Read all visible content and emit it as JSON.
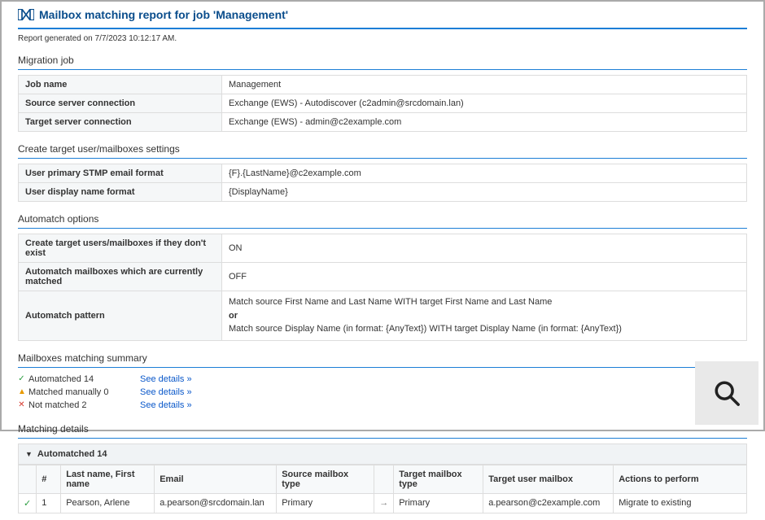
{
  "title": "Mailbox matching report for job 'Management'",
  "generated": "Report generated on 7/7/2023 10:12:17 AM.",
  "section1": {
    "title": "Migration job",
    "rows": [
      {
        "k": "Job name",
        "v": "Management"
      },
      {
        "k": "Source server connection",
        "v": "Exchange (EWS) - Autodiscover (c2admin@srcdomain.lan)"
      },
      {
        "k": "Target server connection",
        "v": "Exchange (EWS) - admin@c2example.com"
      }
    ]
  },
  "section2": {
    "title": "Create target user/mailboxes settings",
    "rows": [
      {
        "k": "User primary STMP email format",
        "v": "{F}.{LastName}@c2example.com"
      },
      {
        "k": "User display name format",
        "v": "{DisplayName}"
      }
    ]
  },
  "section3": {
    "title": "Automatch options",
    "rows": [
      {
        "k": "Create target users/mailboxes if they don't exist",
        "v": "ON"
      },
      {
        "k": "Automatch mailboxes which are currently matched",
        "v": "OFF"
      }
    ],
    "pattern_label": "Automatch pattern",
    "pattern_line1": "Match source First Name and Last Name WITH target First Name and Last Name",
    "pattern_or": "or",
    "pattern_line2": "Match source Display Name (in format: {AnyText}) WITH target Display Name (in format: {AnyText})"
  },
  "summary": {
    "title": "Mailboxes matching summary",
    "rows": [
      {
        "mark": "✓",
        "cls": "green",
        "label": "Automatched 14"
      },
      {
        "mark": "▲",
        "cls": "orange",
        "label": "Matched manually 0"
      },
      {
        "mark": "✕",
        "cls": "red",
        "label": "Not matched 2"
      }
    ],
    "link": "See details »"
  },
  "details": {
    "title": "Matching details",
    "group_label": "Automatched 14",
    "headers": {
      "idx": "#",
      "name": "Last name, First name",
      "email": "Email",
      "src": "Source mailbox type",
      "tgt": "Target mailbox type",
      "tgtuser": "Target user mailbox",
      "actions": "Actions to perform"
    },
    "row1": {
      "idx": "1",
      "name": "Pearson, Arlene",
      "email": "a.pearson@srcdomain.lan",
      "src": "Primary",
      "tgt": "Primary",
      "tgtuser": "a.pearson@c2example.com",
      "actions": "Migrate to existing"
    }
  }
}
